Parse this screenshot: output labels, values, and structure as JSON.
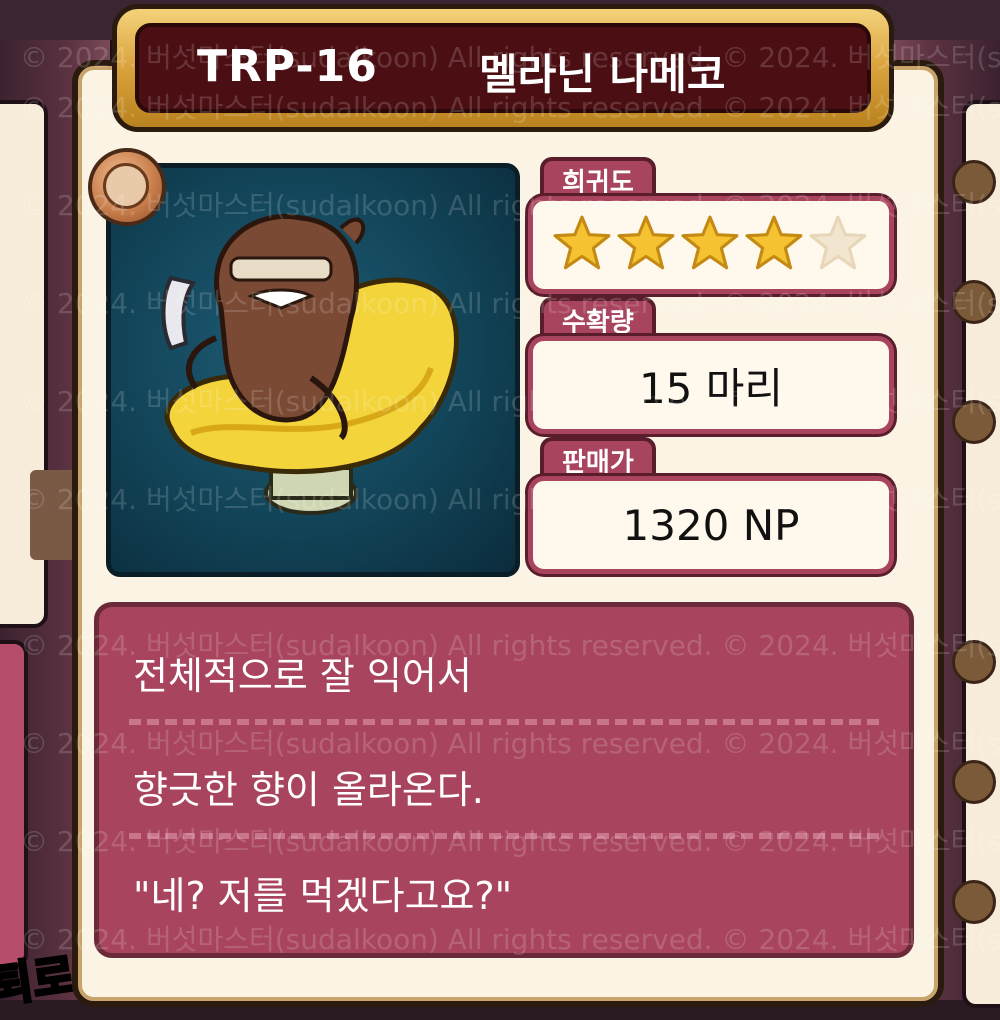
{
  "item": {
    "code": "TRP-16",
    "name": "멜라닌 나메코"
  },
  "rarity": {
    "label": "희귀도",
    "stars_filled": 4,
    "stars_total": 5
  },
  "harvest": {
    "label": "수확량",
    "value": "15 마리"
  },
  "price": {
    "label": "판매가",
    "value": "1320 NP"
  },
  "description": {
    "lines": [
      "전체적으로 잘 익어서",
      "향긋한 향이 올라온다.",
      "\"네? 저를 먹겠다고요?\""
    ]
  },
  "watermark": "© 2024. 버섯마스터(sudalkoon) All rights reserved.  © 2024. 버섯마스터(sudalkoon) All rights reserved.",
  "bottom_badge": "퇴로",
  "colors": {
    "title_bg": "#4a0e13",
    "panel_accent": "#a8445e",
    "star_filled": "#f5c232",
    "star_empty": "#f3e6d0"
  }
}
